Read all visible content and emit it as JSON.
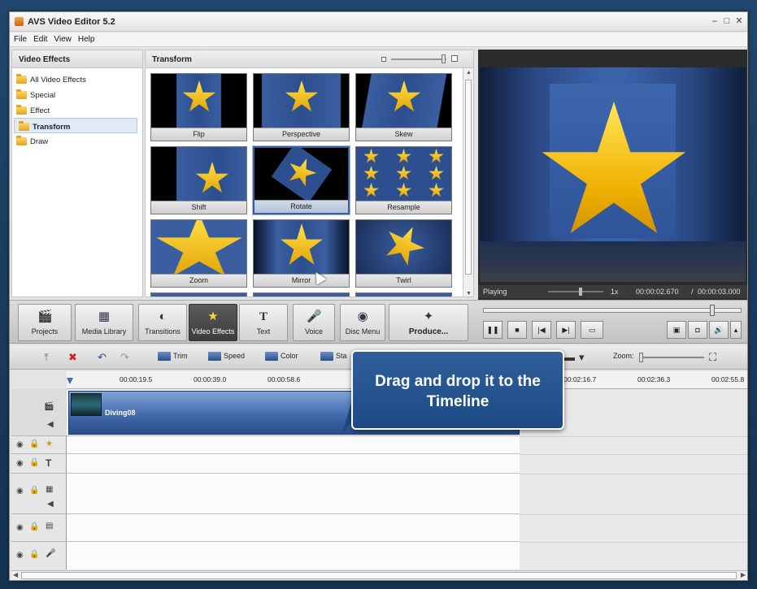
{
  "window": {
    "title": "AVS Video Editor 5.2"
  },
  "menu": [
    "File",
    "Edit",
    "View",
    "Help"
  ],
  "left_panel": {
    "header": "Video Effects",
    "items": [
      {
        "label": "All Video Effects",
        "selected": false
      },
      {
        "label": "Special",
        "selected": false
      },
      {
        "label": "Effect",
        "selected": false
      },
      {
        "label": "Transform",
        "selected": true
      },
      {
        "label": "Draw",
        "selected": false
      }
    ]
  },
  "effects_panel": {
    "header": "Transform",
    "tiles": [
      {
        "label": "Flip"
      },
      {
        "label": "Perspective"
      },
      {
        "label": "Skew"
      },
      {
        "label": "Shift"
      },
      {
        "label": "Rotate",
        "selected": true
      },
      {
        "label": "Resample"
      },
      {
        "label": "Zoom"
      },
      {
        "label": "Mirror"
      },
      {
        "label": "Twirl"
      }
    ]
  },
  "preview": {
    "status": "Playing",
    "speed": "1x",
    "position": "00:00:02.670",
    "duration": "00:00:03.000",
    "separator": "/"
  },
  "toolbar": {
    "buttons": [
      {
        "label": "Projects",
        "icon": "clapper-icon"
      },
      {
        "label": "Media Library",
        "icon": "film-icon"
      },
      {
        "label": "Transitions",
        "icon": "transition-icon"
      },
      {
        "label": "Video Effects",
        "icon": "star-effect-icon",
        "active": true
      },
      {
        "label": "Text",
        "icon": "text-icon"
      },
      {
        "label": "Voice",
        "icon": "microphone-icon"
      },
      {
        "label": "Disc Menu",
        "icon": "disc-icon"
      },
      {
        "label": "Produce...",
        "icon": "produce-icon"
      }
    ]
  },
  "timeline_toolbar": {
    "trim": "Trim",
    "speed": "Speed",
    "color": "Color",
    "stabilize_partial": "Sta",
    "zoom_label": "Zoom:"
  },
  "ruler": {
    "ticks": [
      "00:00:19.5",
      "00:00:39.0",
      "00:00:58.6",
      "00:02:16.7",
      "00:02:36.3",
      "00:02:55.8"
    ]
  },
  "clip": {
    "name": "Diving08"
  },
  "bubble": {
    "line1": "Drag and drop it to the",
    "line2": "Timeline"
  },
  "colors": {
    "accent": "#1d4a84",
    "star": "#f0b000"
  }
}
